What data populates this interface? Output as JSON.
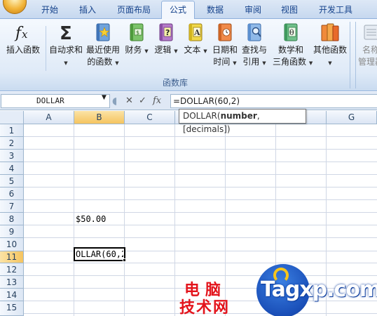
{
  "tabs": [
    "开始",
    "插入",
    "页面布局",
    "公式",
    "数据",
    "审阅",
    "视图",
    "开发工具"
  ],
  "active_tab": "公式",
  "ribbon": {
    "insert_function": "插入函数",
    "autosum": "自动求和",
    "recent_line1": "最近使用",
    "recent_line2": "的函数",
    "financial": "财务",
    "logical": "逻辑",
    "text": "文本",
    "datetime_line1": "日期和",
    "datetime_line2": "时间",
    "lookup_line1": "查找与",
    "lookup_line2": "引用",
    "math_line1": "数学和",
    "math_line2": "三角函数",
    "more": "其他函数",
    "name_line1": "名称",
    "name_line2": "管理器",
    "group_label": "函数库",
    "icons": {
      "insert_function": "fx-icon",
      "autosum": "sigma-icon",
      "recent": "book-star-icon",
      "financial": "book-money-icon",
      "logical": "book-question-icon",
      "text": "book-a-icon",
      "datetime": "book-clock-icon",
      "lookup": "book-magnifier-icon",
      "math": "book-theta-icon",
      "more": "books-icon",
      "name_manager": "name-manager-icon"
    }
  },
  "formula_bar": {
    "name_box": "DOLLAR",
    "formula": "=DOLLAR(60,2)",
    "cancel_symbol": "✕",
    "enter_symbol": "✓",
    "fx_symbol": "fx"
  },
  "tooltip": {
    "func": "DOLLAR(",
    "arg_bold": "number",
    "rest": ", [decimals])"
  },
  "columns": [
    "A",
    "B",
    "C",
    "D",
    "E",
    "F",
    "G"
  ],
  "rows": [
    "1",
    "2",
    "3",
    "4",
    "5",
    "6",
    "7",
    "8",
    "9",
    "10",
    "11",
    "12",
    "13",
    "14",
    "15"
  ],
  "selected_column": "B",
  "selected_row": "11",
  "cells": {
    "B8": "$50.00",
    "B11": "OLLAR(60,2"
  },
  "watermark": {
    "line1": "电脑",
    "line2": "技术网",
    "domain": "Tagxp.com"
  },
  "colors": {
    "ribbon_text": "#15428b",
    "selected_header": "#f5c45f",
    "watermark_red": "#e3141c",
    "watermark_blue": "#1a4fb8"
  }
}
